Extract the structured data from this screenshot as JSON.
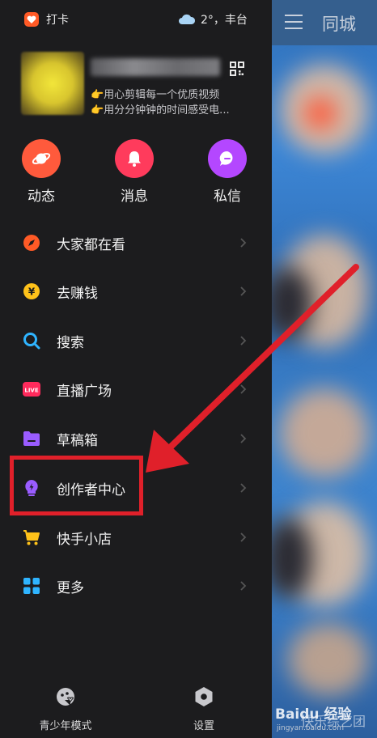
{
  "status": {
    "checkin_label": "打卡",
    "weather": "2°，丰台"
  },
  "profile": {
    "bio_line1": "👉用心剪辑每一个优质视频",
    "bio_line2": "👉用分分钟钟的时间感受电..."
  },
  "quick_actions": [
    {
      "label": "动态",
      "icon": "planet-icon",
      "color": "#ff5a3c"
    },
    {
      "label": "消息",
      "icon": "bell-icon",
      "color": "#ff3b5c"
    },
    {
      "label": "私信",
      "icon": "chat-icon",
      "color": "#b447ff"
    }
  ],
  "menu": [
    {
      "label": "大家都在看",
      "icon": "compass-icon",
      "color": "#ff5a26"
    },
    {
      "label": "去赚钱",
      "icon": "yen-icon",
      "color": "#ffc21a"
    },
    {
      "label": "搜索",
      "icon": "search-icon",
      "color": "#2fb4ff"
    },
    {
      "label": "直播广场",
      "icon": "live-icon",
      "color": "#ff2a5c",
      "badge": "LIVE"
    },
    {
      "label": "草稿箱",
      "icon": "folder-icon",
      "color": "#9a5cff"
    },
    {
      "label": "创作者中心",
      "icon": "bulb-icon",
      "color": "#9a5cff"
    },
    {
      "label": "快手小店",
      "icon": "cart-icon",
      "color": "#ffc21a"
    },
    {
      "label": "更多",
      "icon": "grid-icon",
      "color": "#2fb4ff"
    }
  ],
  "bottom": {
    "teen_mode": "青少年模式",
    "settings": "设置"
  },
  "right_panel": {
    "title": "同城"
  },
  "watermark": {
    "brand": "Baidu 经验",
    "url": "jingyan.baidu.com",
    "overlay": "快乐综艺团"
  },
  "highlight_color": "#e0202a"
}
